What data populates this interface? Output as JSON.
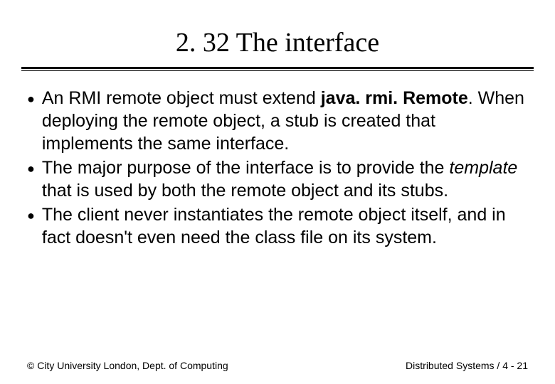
{
  "title": "2. 32 The interface",
  "bullets": [
    {
      "segments": [
        {
          "text": "An RMI remote object must extend ",
          "style": "normal"
        },
        {
          "text": "java. rmi. Remote",
          "style": "bold"
        },
        {
          "text": ". When deploying the remote object, a stub is created that implements the same interface.",
          "style": "normal"
        }
      ]
    },
    {
      "segments": [
        {
          "text": "The major purpose of the interface is to provide the ",
          "style": "normal"
        },
        {
          "text": "template",
          "style": "italic"
        },
        {
          "text": " that is used by both the remote object and its stubs.",
          "style": "normal"
        }
      ]
    },
    {
      "segments": [
        {
          "text": "The client never instantiates the remote object itself, and in fact doesn't even need the class file on its system.",
          "style": "normal"
        }
      ]
    }
  ],
  "footer": {
    "left": "© City University London, Dept. of Computing",
    "right": "Distributed Systems / 4 - 21"
  }
}
